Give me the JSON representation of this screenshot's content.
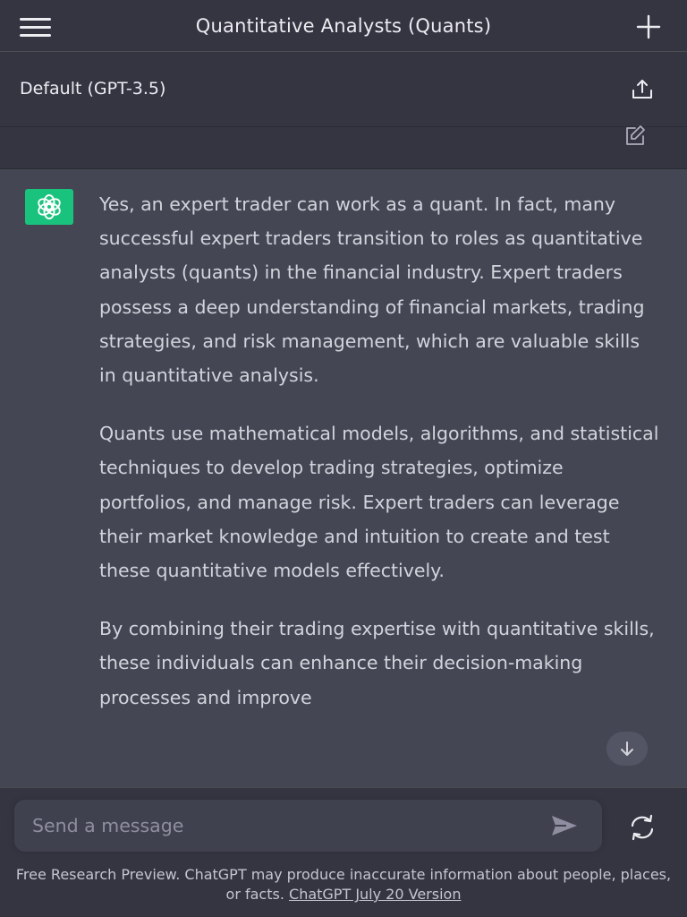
{
  "header": {
    "title": "Quantitative Analysts (Quants)",
    "menu_icon": "hamburger-menu-icon",
    "new_chat_icon": "plus-icon"
  },
  "model_bar": {
    "label": "Default (GPT-3.5)",
    "share_icon": "share-icon",
    "edit_icon": "edit-icon"
  },
  "answer": {
    "avatar_icon": "openai-logo-icon",
    "paragraphs": [
      "Yes, an expert trader can work as a quant. In fact, many successful expert traders transition to roles as quantitative analysts (quants) in the financial industry. Expert traders possess a deep understanding of financial markets, trading strategies, and risk management, which are valuable skills in quantitative analysis.",
      "Quants use mathematical models, algorithms, and statistical techniques to develop trading strategies, optimize portfolios, and manage risk. Expert traders can leverage their market knowledge and intuition to create and test these quantitative models effectively.",
      "By combining their trading expertise with quantitative skills, these individuals can enhance their decision-making processes and improve"
    ],
    "scroll_icon": "arrow-down-icon"
  },
  "composer": {
    "placeholder": "Send a message",
    "send_icon": "send-icon",
    "regenerate_icon": "regenerate-icon"
  },
  "footer": {
    "disclaimer_text": "Free Research Preview. ChatGPT may produce inaccurate information about people, places, or facts.",
    "version_link": "ChatGPT July 20 Version"
  },
  "colors": {
    "background": "#343541",
    "answer_background": "#444654",
    "accent": "#19c37d",
    "input_background": "#40414f"
  }
}
